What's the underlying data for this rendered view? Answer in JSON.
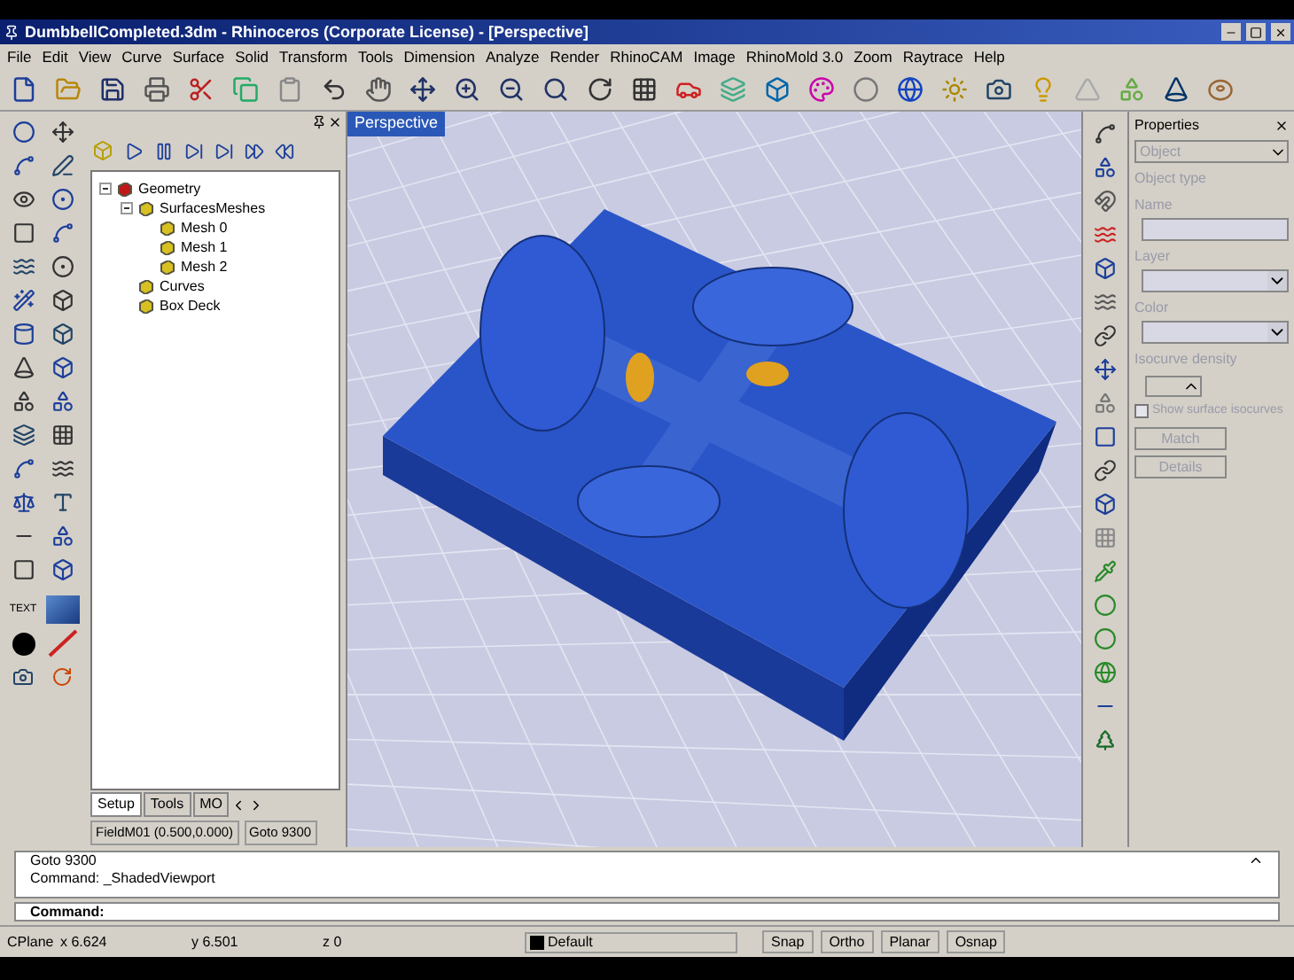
{
  "window": {
    "title": "DumbbellCompleted.3dm - Rhinoceros (Corporate License) - [Perspective]"
  },
  "menu": [
    "File",
    "Edit",
    "View",
    "Curve",
    "Surface",
    "Solid",
    "Transform",
    "Tools",
    "Dimension",
    "Analyze",
    "Render",
    "RhinoCAM",
    "Image",
    "RhinoMold 3.0",
    "Zoom",
    "Raytrace",
    "Help"
  ],
  "left_toolbar": {
    "text_button": "TEXT"
  },
  "panel": {
    "tree": [
      {
        "label": "Geometry",
        "expanded": true,
        "children": [
          {
            "label": "SurfacesMeshes",
            "expanded": true,
            "children": [
              {
                "label": "Mesh 0"
              },
              {
                "label": "Mesh 1"
              },
              {
                "label": "Mesh 2"
              }
            ]
          },
          {
            "label": "Curves"
          },
          {
            "label": "Box Deck"
          }
        ]
      }
    ],
    "tabs": [
      {
        "label": "Setup",
        "selected": true
      },
      {
        "label": "Tools",
        "selected": false
      },
      {
        "label": "MO",
        "selected": false
      }
    ],
    "status": [
      "FieldM01 (0.500,0.000)",
      "Goto 9300"
    ]
  },
  "viewport": {
    "label": "Perspective"
  },
  "properties": {
    "title": "Properties",
    "disabled": true,
    "object_select": "Object",
    "object_type": "Object type",
    "name_label": "Name",
    "layer_label": "Layer",
    "color_label": "Color",
    "isocurve_label": "Isocurve density",
    "checkbox": {
      "label": "Show surface isocurves",
      "checked": false
    },
    "buttons": [
      "Match",
      "Details"
    ]
  },
  "command": {
    "history": [
      "Goto 9300",
      "Command: _ShadedViewport"
    ],
    "prompt": "Command:"
  },
  "status_bar": {
    "cplane": "CPlane",
    "x": "x 6.624",
    "y": "y 6.501",
    "z": "z 0",
    "layer": "Default",
    "toggles": [
      {
        "label": "Snap",
        "on": false
      },
      {
        "label": "Ortho",
        "on": false
      },
      {
        "label": "Planar",
        "on": false
      },
      {
        "label": "Osnap",
        "on": false
      }
    ]
  }
}
